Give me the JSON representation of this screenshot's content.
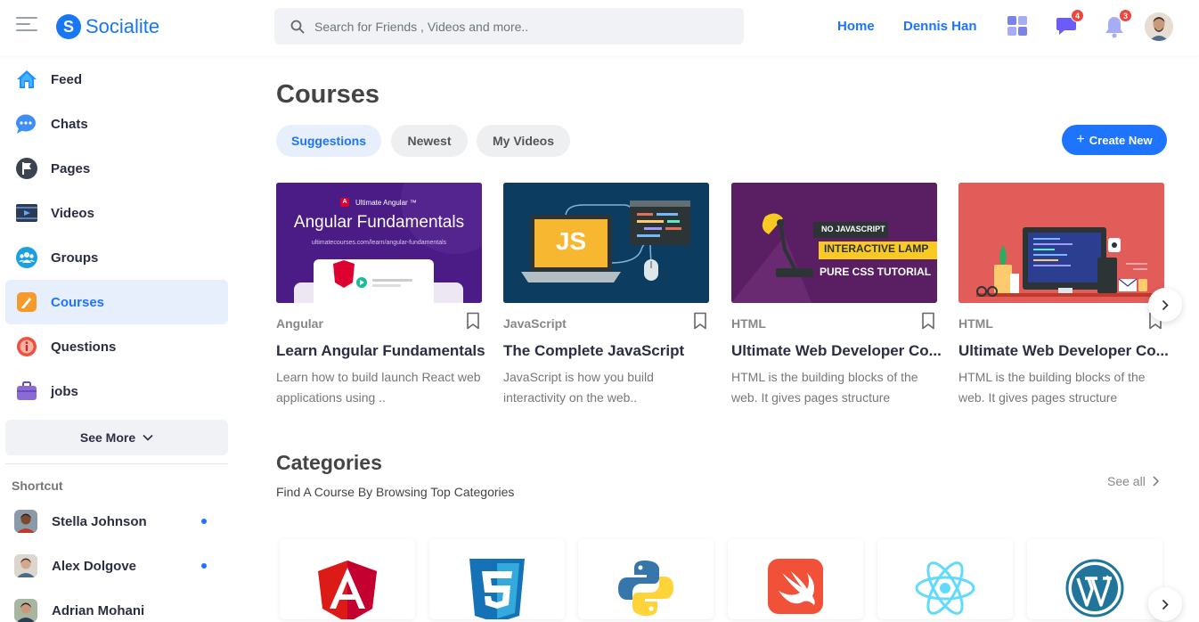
{
  "header": {
    "logo_letter": "S",
    "logo_text": "Socialite",
    "search_placeholder": "Search for Friends , Videos and more..",
    "nav": [
      "Home",
      "Dennis Han"
    ],
    "message_badge": "4",
    "notification_badge": "3"
  },
  "sidebar": {
    "items": [
      {
        "label": "Feed",
        "icon": "home-icon",
        "active": false
      },
      {
        "label": "Chats",
        "icon": "chat-icon",
        "active": false
      },
      {
        "label": "Pages",
        "icon": "flag-icon",
        "active": false
      },
      {
        "label": "Videos",
        "icon": "video-icon",
        "active": false
      },
      {
        "label": "Groups",
        "icon": "groups-icon",
        "active": false
      },
      {
        "label": "Courses",
        "icon": "courses-icon",
        "active": true
      },
      {
        "label": "Questions",
        "icon": "question-icon",
        "active": false
      },
      {
        "label": "jobs",
        "icon": "briefcase-icon",
        "active": false
      }
    ],
    "see_more": "See More",
    "shortcut_title": "Shortcut",
    "contacts": [
      {
        "name": "Stella Johnson",
        "online": true
      },
      {
        "name": "Alex Dolgove",
        "online": true
      },
      {
        "name": "Adrian Mohani",
        "online": false
      }
    ]
  },
  "main": {
    "title": "Courses",
    "tabs": [
      "Suggestions",
      "Newest",
      "My Videos"
    ],
    "active_tab": "Suggestions",
    "create_label": "Create New",
    "courses": [
      {
        "category": "Angular",
        "title": "Learn Angular Fundamentals",
        "desc": "Learn how to build launch React web applications using ..",
        "thumb": {
          "brand": "Ultimate Angular ™",
          "heading": "Angular Fundamentals",
          "url": "ultimatecourses.com/learn/angular-fundamentals",
          "logo_letter": "A"
        }
      },
      {
        "category": "JavaScript",
        "title": "The Complete JavaScript",
        "desc": "JavaScript is how you build interactivity on the web..",
        "thumb": {
          "badge": "JS"
        }
      },
      {
        "category": "HTML",
        "title": "Ultimate Web Developer Co...",
        "desc": "HTML is the building blocks of the web. It gives pages structure",
        "thumb": {
          "line1": "NO JAVASCRIPT",
          "line2": "INTERACTIVE LAMP",
          "line3": "PURE CSS TUTORIAL"
        }
      },
      {
        "category": "HTML",
        "title": "Ultimate Web Developer Co...",
        "desc": "HTML is the building blocks of the web. It gives pages structure",
        "thumb": {}
      }
    ],
    "categories": {
      "title": "Categories",
      "subtitle": "Find A Course By Browsing Top Categories",
      "see_all": "See all",
      "items": [
        "angular-icon",
        "css3-icon",
        "python-icon",
        "swift-icon",
        "react-icon",
        "wordpress-icon"
      ]
    }
  },
  "colors": {
    "primary": "#1e74fd",
    "brand": "#1877f2",
    "badge": "#f0453a",
    "angular_bg": "#4b1c86",
    "js_bg": "#0d3c61",
    "lamp_bg": "#5a1f62",
    "html_bg": "#e25c5a"
  }
}
